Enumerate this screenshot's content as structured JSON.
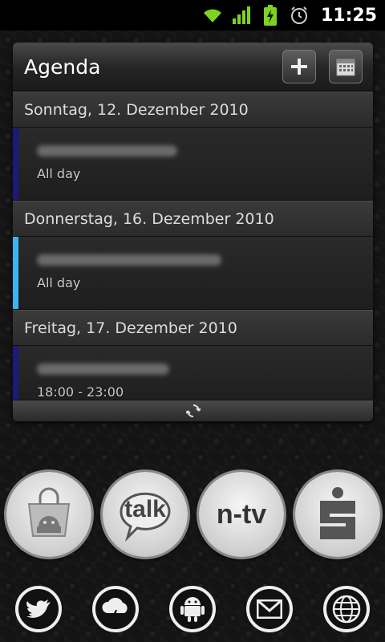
{
  "status_bar": {
    "time": "11:25",
    "icons": [
      "wifi-icon",
      "signal-icon",
      "battery-charging-icon",
      "alarm-icon"
    ]
  },
  "agenda": {
    "title": "Agenda",
    "buttons": [
      "add-icon",
      "calendar-icon"
    ],
    "days": [
      {
        "label": "Sonntag, 12. Dezember 2010",
        "event": {
          "time": "All day",
          "color": "#1a1a7a"
        }
      },
      {
        "label": "Donnerstag, 16. Dezember 2010",
        "event": {
          "time": "All day",
          "color": "#3ab4f2"
        }
      },
      {
        "label": "Freitag, 17. Dezember 2010",
        "event": {
          "time": "18:00 - 23:00",
          "color": "#1a1a7a"
        }
      }
    ],
    "footer_icon": "refresh-icon"
  },
  "apps": [
    {
      "name": "market-icon",
      "label": ""
    },
    {
      "name": "talk-icon",
      "label": "talk"
    },
    {
      "name": "ntv-icon",
      "label": "n-tv"
    },
    {
      "name": "sparkasse-icon",
      "label": ""
    }
  ],
  "dock": [
    "twitter-icon",
    "weather-icon",
    "android-icon",
    "mail-icon",
    "browser-icon"
  ]
}
